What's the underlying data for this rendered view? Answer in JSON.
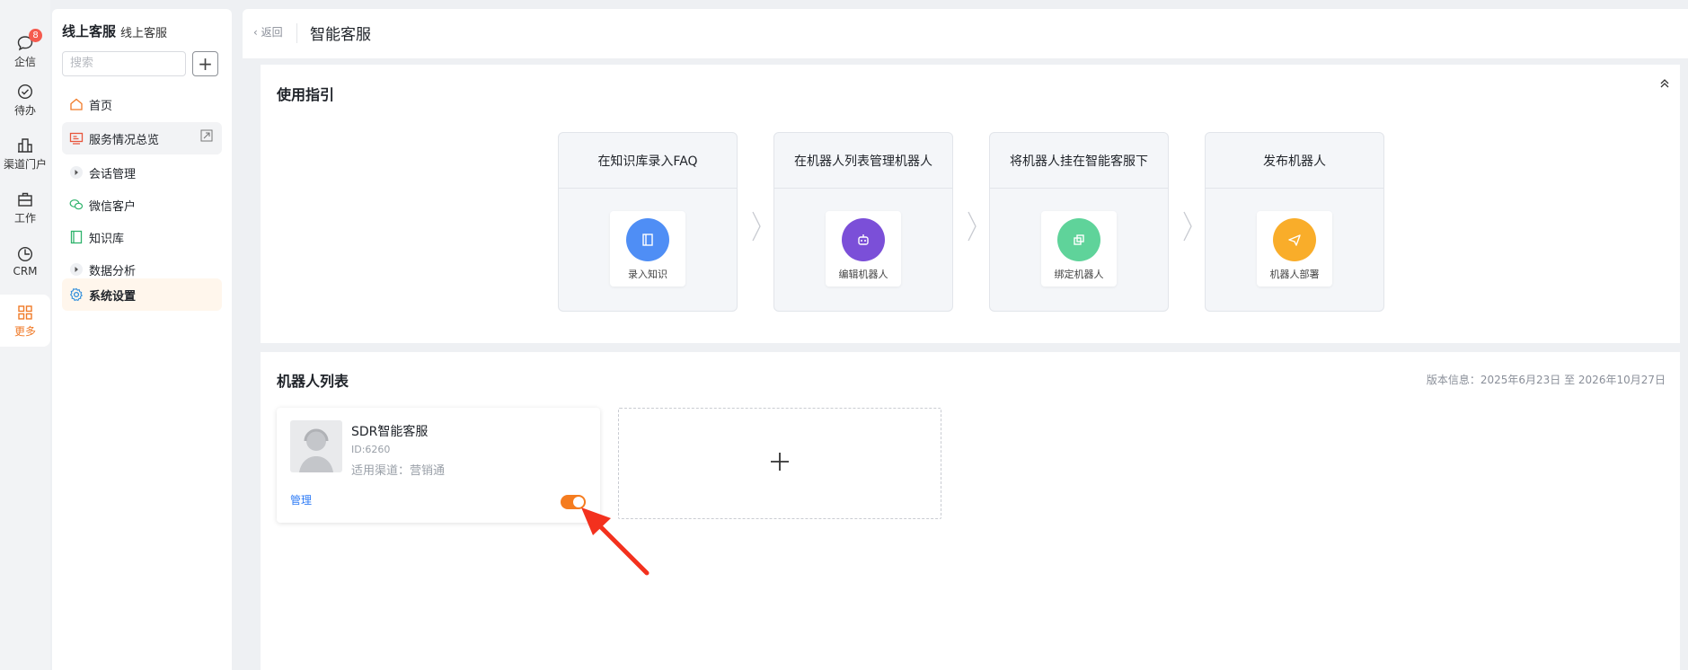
{
  "rail": {
    "items": [
      {
        "label": "企信",
        "icon": "chat-bubble-icon",
        "badge": "8"
      },
      {
        "label": "待办",
        "icon": "check-circle-icon"
      },
      {
        "label": "渠道门户",
        "icon": "building-icon"
      },
      {
        "label": "工作",
        "icon": "briefcase-icon"
      },
      {
        "label": "CRM",
        "icon": "pie-clock-icon"
      },
      {
        "label": "更多",
        "icon": "grid-icon",
        "active": true
      }
    ]
  },
  "sidebar": {
    "title": "线上客服",
    "subtitle": "线上客服",
    "search_placeholder": "搜索",
    "add_label": "+",
    "items": [
      {
        "label": "首页",
        "icon": "home-icon"
      },
      {
        "label": "服务情况总览",
        "icon": "monitor-icon"
      },
      {
        "label": "会话管理",
        "icon": "caret-right-icon"
      },
      {
        "label": "微信客户",
        "icon": "wechat-icon"
      },
      {
        "label": "知识库",
        "icon": "book-icon"
      },
      {
        "label": "数据分析",
        "icon": "caret-right-icon"
      },
      {
        "label": "系统设置",
        "icon": "gear-icon"
      }
    ]
  },
  "header": {
    "back_label": "返回",
    "title": "智能客服"
  },
  "guide": {
    "title": "使用指引",
    "steps": [
      {
        "title": "在知识库录入FAQ",
        "action": "录入知识",
        "color": "#4f8ef5",
        "icon": "book-icon"
      },
      {
        "title": "在机器人列表管理机器人",
        "action": "编辑机器人",
        "color": "#7b4fd8",
        "icon": "robot-icon"
      },
      {
        "title": "将机器人挂在智能客服下",
        "action": "绑定机器人",
        "color": "#5fd39a",
        "icon": "link-icon"
      },
      {
        "title": "发布机器人",
        "action": "机器人部署",
        "color": "#f9ad2a",
        "icon": "send-icon"
      }
    ]
  },
  "bot_list": {
    "title": "机器人列表",
    "version": "版本信息：2025年6月23日 至 2026年10月27日",
    "bots": [
      {
        "name": "SDR智能客服",
        "id": "ID:6260",
        "channel": "适用渠道：营销通",
        "manage_label": "管理",
        "enabled": true
      }
    ]
  },
  "colors": {
    "accent": "#f57c1f",
    "link": "#2f7cf6",
    "annotation_arrow": "#f3311e"
  }
}
